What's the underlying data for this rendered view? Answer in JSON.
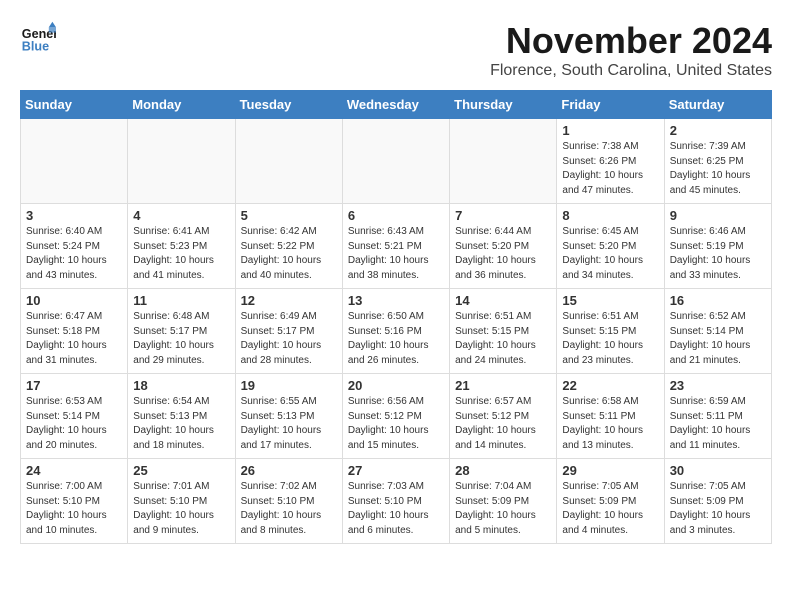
{
  "logo": {
    "line1": "General",
    "line2": "Blue"
  },
  "title": "November 2024",
  "location": "Florence, South Carolina, United States",
  "weekdays": [
    "Sunday",
    "Monday",
    "Tuesday",
    "Wednesday",
    "Thursday",
    "Friday",
    "Saturday"
  ],
  "weeks": [
    [
      {
        "day": "",
        "info": ""
      },
      {
        "day": "",
        "info": ""
      },
      {
        "day": "",
        "info": ""
      },
      {
        "day": "",
        "info": ""
      },
      {
        "day": "",
        "info": ""
      },
      {
        "day": "1",
        "info": "Sunrise: 7:38 AM\nSunset: 6:26 PM\nDaylight: 10 hours\nand 47 minutes."
      },
      {
        "day": "2",
        "info": "Sunrise: 7:39 AM\nSunset: 6:25 PM\nDaylight: 10 hours\nand 45 minutes."
      }
    ],
    [
      {
        "day": "3",
        "info": "Sunrise: 6:40 AM\nSunset: 5:24 PM\nDaylight: 10 hours\nand 43 minutes."
      },
      {
        "day": "4",
        "info": "Sunrise: 6:41 AM\nSunset: 5:23 PM\nDaylight: 10 hours\nand 41 minutes."
      },
      {
        "day": "5",
        "info": "Sunrise: 6:42 AM\nSunset: 5:22 PM\nDaylight: 10 hours\nand 40 minutes."
      },
      {
        "day": "6",
        "info": "Sunrise: 6:43 AM\nSunset: 5:21 PM\nDaylight: 10 hours\nand 38 minutes."
      },
      {
        "day": "7",
        "info": "Sunrise: 6:44 AM\nSunset: 5:20 PM\nDaylight: 10 hours\nand 36 minutes."
      },
      {
        "day": "8",
        "info": "Sunrise: 6:45 AM\nSunset: 5:20 PM\nDaylight: 10 hours\nand 34 minutes."
      },
      {
        "day": "9",
        "info": "Sunrise: 6:46 AM\nSunset: 5:19 PM\nDaylight: 10 hours\nand 33 minutes."
      }
    ],
    [
      {
        "day": "10",
        "info": "Sunrise: 6:47 AM\nSunset: 5:18 PM\nDaylight: 10 hours\nand 31 minutes."
      },
      {
        "day": "11",
        "info": "Sunrise: 6:48 AM\nSunset: 5:17 PM\nDaylight: 10 hours\nand 29 minutes."
      },
      {
        "day": "12",
        "info": "Sunrise: 6:49 AM\nSunset: 5:17 PM\nDaylight: 10 hours\nand 28 minutes."
      },
      {
        "day": "13",
        "info": "Sunrise: 6:50 AM\nSunset: 5:16 PM\nDaylight: 10 hours\nand 26 minutes."
      },
      {
        "day": "14",
        "info": "Sunrise: 6:51 AM\nSunset: 5:15 PM\nDaylight: 10 hours\nand 24 minutes."
      },
      {
        "day": "15",
        "info": "Sunrise: 6:51 AM\nSunset: 5:15 PM\nDaylight: 10 hours\nand 23 minutes."
      },
      {
        "day": "16",
        "info": "Sunrise: 6:52 AM\nSunset: 5:14 PM\nDaylight: 10 hours\nand 21 minutes."
      }
    ],
    [
      {
        "day": "17",
        "info": "Sunrise: 6:53 AM\nSunset: 5:14 PM\nDaylight: 10 hours\nand 20 minutes."
      },
      {
        "day": "18",
        "info": "Sunrise: 6:54 AM\nSunset: 5:13 PM\nDaylight: 10 hours\nand 18 minutes."
      },
      {
        "day": "19",
        "info": "Sunrise: 6:55 AM\nSunset: 5:13 PM\nDaylight: 10 hours\nand 17 minutes."
      },
      {
        "day": "20",
        "info": "Sunrise: 6:56 AM\nSunset: 5:12 PM\nDaylight: 10 hours\nand 15 minutes."
      },
      {
        "day": "21",
        "info": "Sunrise: 6:57 AM\nSunset: 5:12 PM\nDaylight: 10 hours\nand 14 minutes."
      },
      {
        "day": "22",
        "info": "Sunrise: 6:58 AM\nSunset: 5:11 PM\nDaylight: 10 hours\nand 13 minutes."
      },
      {
        "day": "23",
        "info": "Sunrise: 6:59 AM\nSunset: 5:11 PM\nDaylight: 10 hours\nand 11 minutes."
      }
    ],
    [
      {
        "day": "24",
        "info": "Sunrise: 7:00 AM\nSunset: 5:10 PM\nDaylight: 10 hours\nand 10 minutes."
      },
      {
        "day": "25",
        "info": "Sunrise: 7:01 AM\nSunset: 5:10 PM\nDaylight: 10 hours\nand 9 minutes."
      },
      {
        "day": "26",
        "info": "Sunrise: 7:02 AM\nSunset: 5:10 PM\nDaylight: 10 hours\nand 8 minutes."
      },
      {
        "day": "27",
        "info": "Sunrise: 7:03 AM\nSunset: 5:10 PM\nDaylight: 10 hours\nand 6 minutes."
      },
      {
        "day": "28",
        "info": "Sunrise: 7:04 AM\nSunset: 5:09 PM\nDaylight: 10 hours\nand 5 minutes."
      },
      {
        "day": "29",
        "info": "Sunrise: 7:05 AM\nSunset: 5:09 PM\nDaylight: 10 hours\nand 4 minutes."
      },
      {
        "day": "30",
        "info": "Sunrise: 7:05 AM\nSunset: 5:09 PM\nDaylight: 10 hours\nand 3 minutes."
      }
    ]
  ]
}
